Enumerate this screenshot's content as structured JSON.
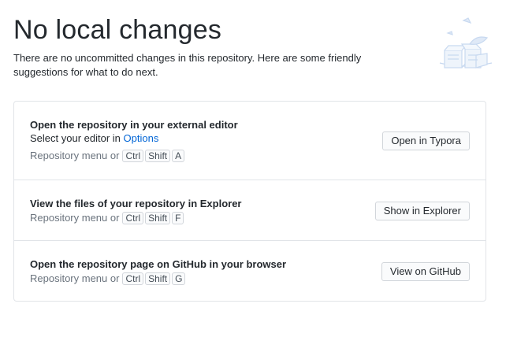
{
  "header": {
    "title": "No local changes",
    "subtitle": "There are no uncommitted changes in this repository. Here are some friendly suggestions for what to do next."
  },
  "illustration": {
    "icon": "empty-changes-illustration"
  },
  "actions": [
    {
      "title": "Open the repository in your external editor",
      "description_prefix": "Select your editor in ",
      "description_link": "Options",
      "shortcut_prefix": "Repository menu or",
      "keys": [
        "Ctrl",
        "Shift",
        "A"
      ],
      "button_label": "Open in Typora"
    },
    {
      "title": "View the files of your repository in Explorer",
      "shortcut_prefix": "Repository menu or",
      "keys": [
        "Ctrl",
        "Shift",
        "F"
      ],
      "button_label": "Show in Explorer"
    },
    {
      "title": "Open the repository page on GitHub in your browser",
      "shortcut_prefix": "Repository menu or",
      "keys": [
        "Ctrl",
        "Shift",
        "G"
      ],
      "button_label": "View on GitHub"
    }
  ],
  "colors": {
    "link": "#0366d6",
    "border": "#e1e4e8",
    "muted_text": "#6a737d",
    "illustration": "#c8d9f0"
  }
}
